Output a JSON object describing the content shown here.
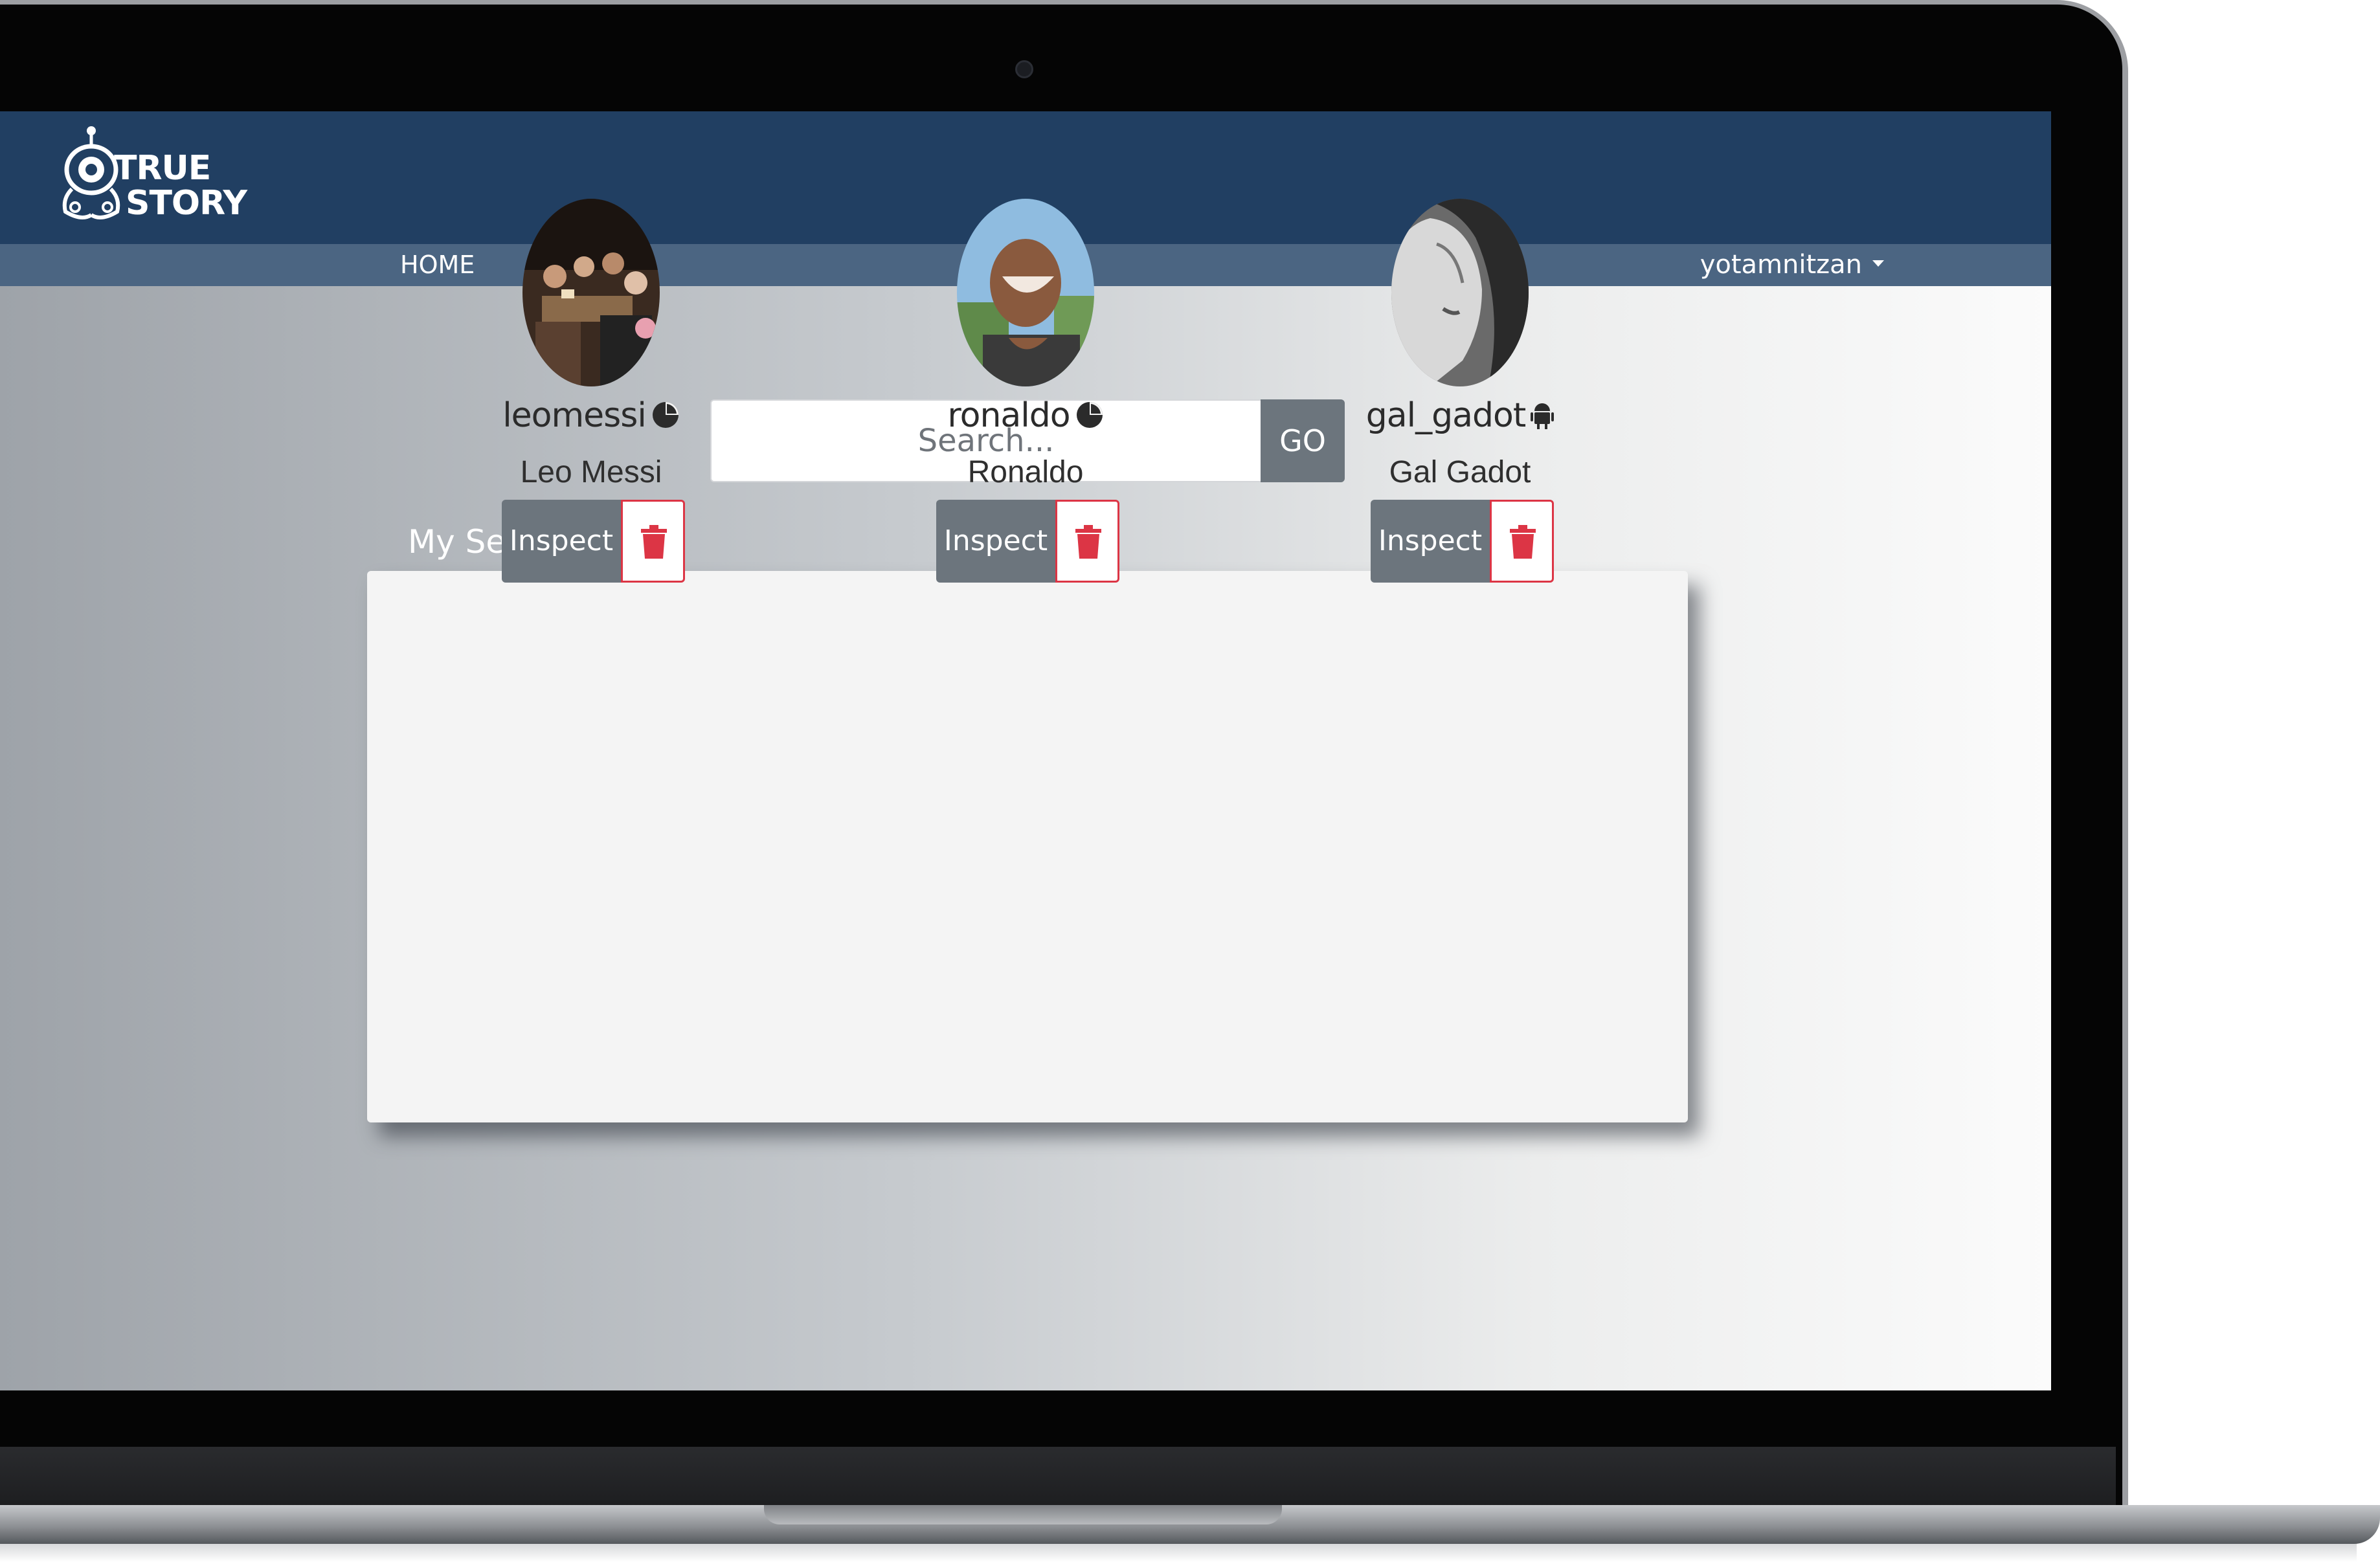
{
  "brand": {
    "logo_line1": "TRUE",
    "logo_line2": "STORY"
  },
  "nav": {
    "home_label": "HOME",
    "user_label": "yotamnitzan"
  },
  "search": {
    "placeholder": "Search...",
    "go_label": "GO"
  },
  "section": {
    "title": "My Searches"
  },
  "profiles": [
    {
      "username": "leomessi",
      "full_name": "Leo Messi",
      "platform_icon": "pie-chart-icon",
      "inspect_label": "Inspect"
    },
    {
      "username": "ronaldo",
      "full_name": "Ronaldo",
      "platform_icon": "pie-chart-icon",
      "inspect_label": "Inspect"
    },
    {
      "username": "gal_gadot",
      "full_name": "Gal Gadot",
      "platform_icon": "android-icon",
      "inspect_label": "Inspect"
    }
  ],
  "colors": {
    "header_bg": "#213f62",
    "navbar_bg": "#4b6582",
    "button_gray": "#6c757d",
    "danger_red": "#dc3545",
    "card_bg": "#f4f4f4"
  }
}
